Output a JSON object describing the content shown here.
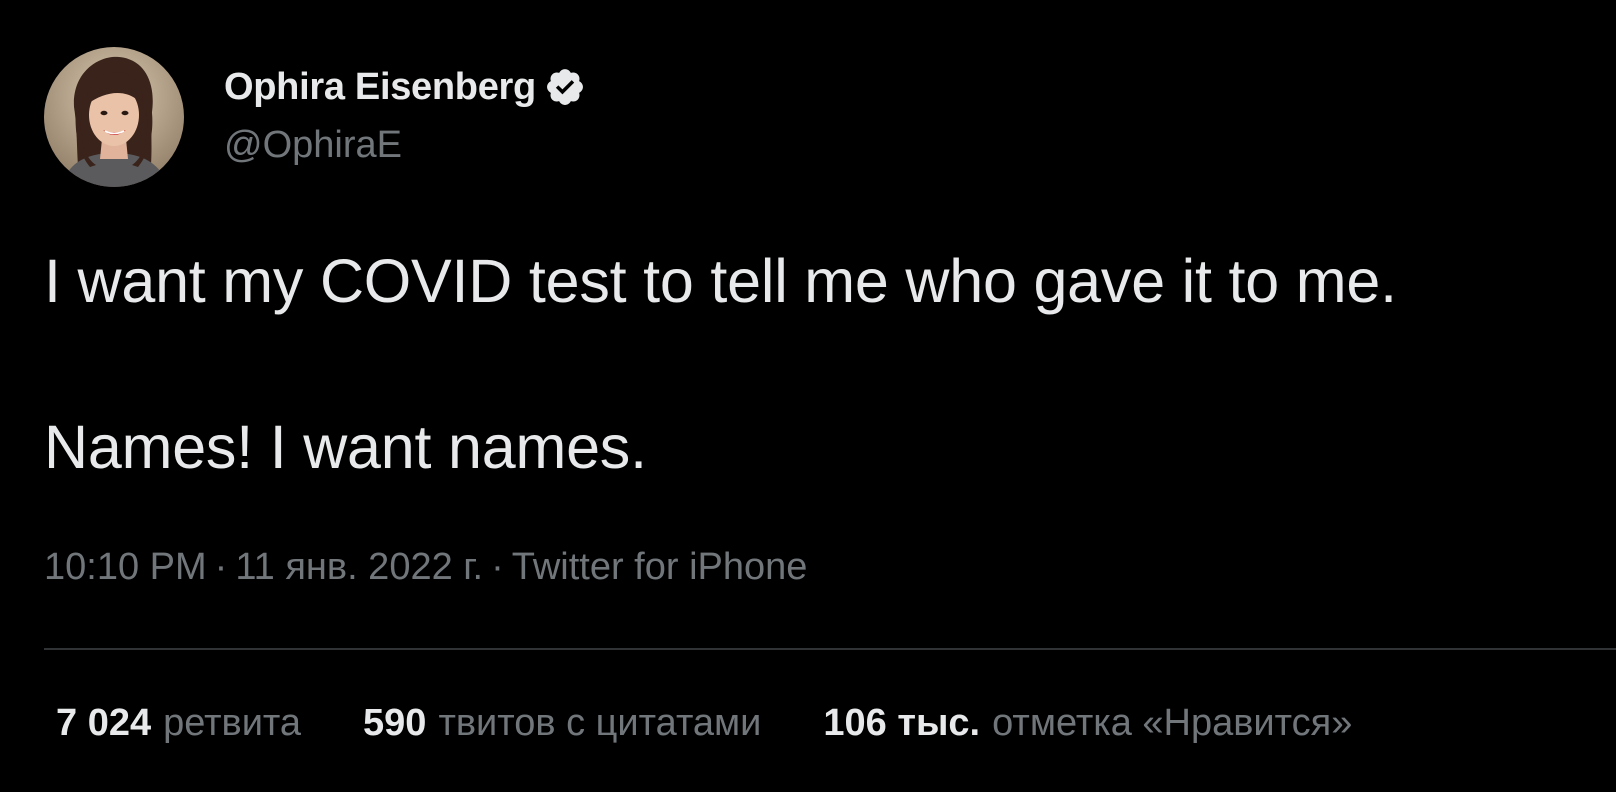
{
  "author": {
    "display_name": "Ophira Eisenberg",
    "handle": "@OphiraE",
    "verified": true,
    "verified_icon": "verified-badge-icon",
    "avatar": "profile-photo"
  },
  "tweet": {
    "lines": [
      "I want my COVID test to tell me who gave it to me.",
      "Names! I want names."
    ],
    "time": "10:10 PM",
    "date": "11 янв. 2022 г.",
    "separator": "·",
    "source": "Twitter for iPhone"
  },
  "stats": {
    "retweets": {
      "count": "7 024",
      "label": "ретвита"
    },
    "quotes": {
      "count": "590",
      "label": "твитов с цитатами"
    },
    "likes": {
      "count": "106 тыс.",
      "label": "отметка «Нравится»"
    }
  },
  "colors": {
    "background": "#000000",
    "primary_text": "#e7e9ea",
    "secondary_text": "#71767b",
    "divider": "#2f3336"
  }
}
